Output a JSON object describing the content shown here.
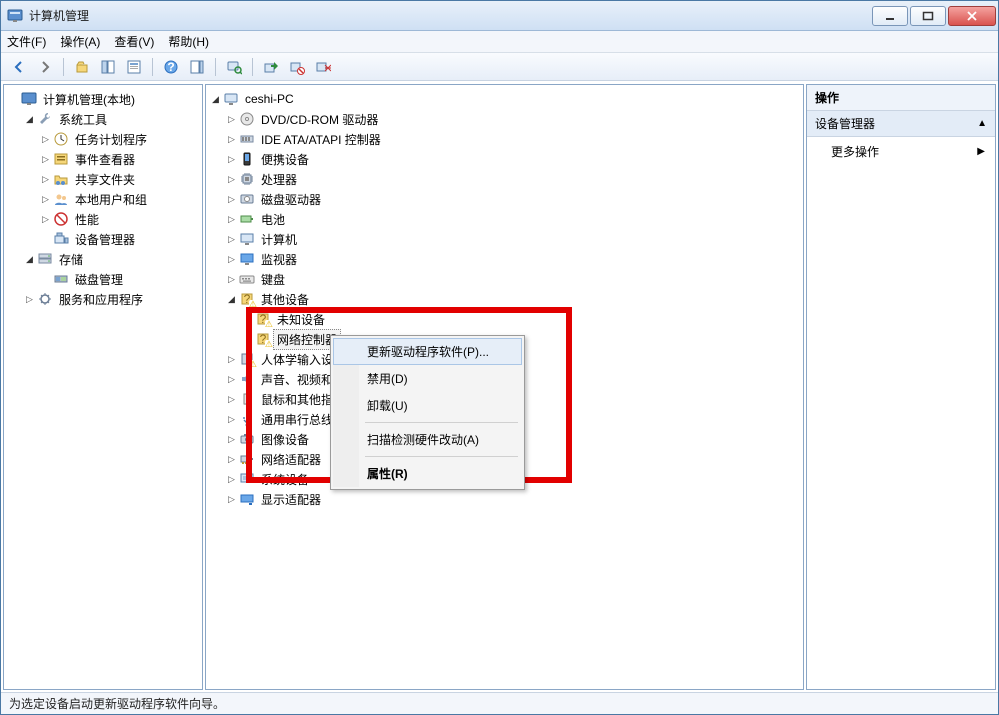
{
  "window": {
    "title": "计算机管理"
  },
  "menu": {
    "file": "文件(F)",
    "action": "操作(A)",
    "view": "查看(V)",
    "help": "帮助(H)"
  },
  "left_tree": {
    "root": "计算机管理(本地)",
    "system_tools": "系统工具",
    "task_scheduler": "任务计划程序",
    "event_viewer": "事件查看器",
    "shared_folders": "共享文件夹",
    "local_users": "本地用户和组",
    "performance": "性能",
    "device_manager": "设备管理器",
    "storage": "存储",
    "disk_mgmt": "磁盘管理",
    "services_apps": "服务和应用程序"
  },
  "center_tree": {
    "root": "ceshi-PC",
    "dvd": "DVD/CD-ROM 驱动器",
    "ide": "IDE ATA/ATAPI 控制器",
    "portable": "便携设备",
    "processor": "处理器",
    "disk_drives": "磁盘驱动器",
    "battery": "电池",
    "computer": "计算机",
    "monitor": "监视器",
    "keyboard": "键盘",
    "other_devices": "其他设备",
    "unknown_device": "未知设备",
    "network_controller": "网络控制器",
    "hid": "人体学输入设备",
    "sound": "声音、视频和游戏控制器",
    "mouse": "鼠标和其他指针设备",
    "usb_serial": "通用串行总线控制器",
    "imaging": "图像设备",
    "network_adapters": "网络适配器",
    "system_devices": "系统设备",
    "display_adapters": "显示适配器"
  },
  "context_menu": {
    "update_driver": "更新驱动程序软件(P)...",
    "disable": "禁用(D)",
    "uninstall": "卸载(U)",
    "scan": "扫描检测硬件改动(A)",
    "properties": "属性(R)"
  },
  "actions_pane": {
    "header": "操作",
    "section": "设备管理器",
    "more": "更多操作"
  },
  "statusbar": {
    "text": "为选定设备启动更新驱动程序软件向导。"
  }
}
